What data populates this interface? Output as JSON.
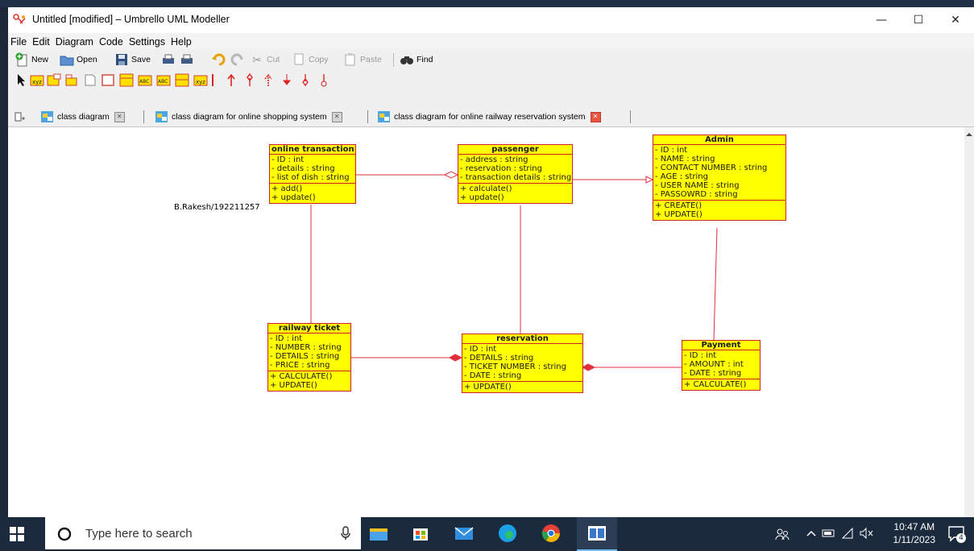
{
  "window": {
    "title": "Untitled [modified] – Umbrello UML Modeller",
    "controls": {
      "minimize": "—",
      "maximize": "☐",
      "close": "✕"
    }
  },
  "menu": [
    "File",
    "Edit",
    "Diagram",
    "Code",
    "Settings",
    "Help"
  ],
  "toolbar": {
    "new": "New",
    "open": "Open",
    "save": "Save",
    "cut": "Cut",
    "copy": "Copy",
    "paste": "Paste",
    "find": "Find"
  },
  "tabs": [
    {
      "label": "class diagram",
      "active": false
    },
    {
      "label": "class diagram for online shopping system",
      "active": false
    },
    {
      "label": "class diagram for online railway reservation system",
      "active": true
    }
  ],
  "diagram": {
    "author_note": "B.Rakesh/192211257",
    "classes": {
      "online_transaction": {
        "name": "online transaction",
        "attributes": [
          "- ID : int",
          "- details : string",
          "- list of dish : string"
        ],
        "operations": [
          "+ add()",
          "+ update()"
        ]
      },
      "passenger": {
        "name": "passenger",
        "attributes": [
          "- address : string",
          "- reservation : string",
          "- transaction details : string"
        ],
        "operations": [
          "+ calculate()",
          "+ update()"
        ]
      },
      "admin": {
        "name": "Admin",
        "attributes": [
          "- ID : int",
          "- NAME : string",
          "- CONTACT NUMBER : string",
          "- AGE : string",
          "- USER NAME : string",
          "- PASSOWRD : string"
        ],
        "operations": [
          "+ CREATE()",
          "+ UPDATE()"
        ]
      },
      "railway_ticket": {
        "name": "railway ticket",
        "attributes": [
          "- ID : int",
          "- NUMBER : string",
          "- DETAILS : string",
          "- PRICE : string"
        ],
        "operations": [
          "+ CALCULATE()",
          "+ UPDATE()"
        ]
      },
      "reservation": {
        "name": "reservation",
        "attributes": [
          "- ID : int",
          "- DETAILS : string",
          "- TICKET NUMBER : string",
          "- DATE : string"
        ],
        "operations": [
          "+ UPDATE()"
        ]
      },
      "payment": {
        "name": "Payment",
        "attributes": [
          "- ID : int",
          "- AMOUNT : int",
          "- DATE : string"
        ],
        "operations": [
          "+ CALCULATE()"
        ]
      }
    }
  },
  "taskbar": {
    "search_placeholder": "Type here to search",
    "time": "10:47 AM",
    "date": "1/11/2023",
    "notification_count": "4"
  },
  "colors": {
    "class_fill": "#ffff00",
    "class_border": "#d0202a",
    "association_line": "#e0303a",
    "taskbar": "#1b2a3d"
  }
}
